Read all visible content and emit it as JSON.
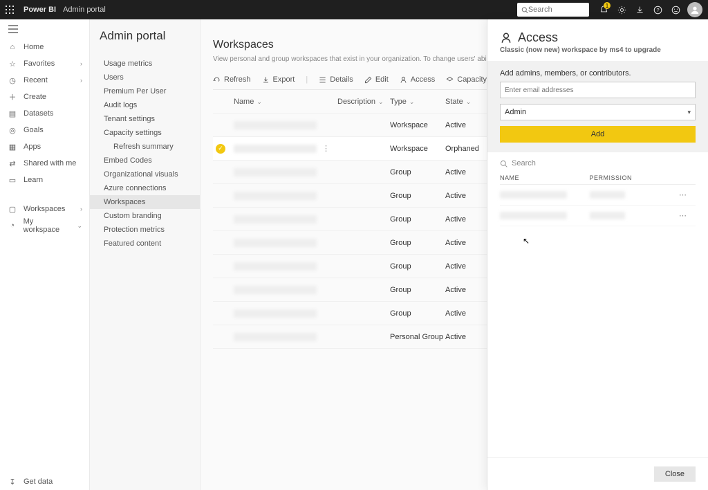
{
  "topbar": {
    "brand": "Power BI",
    "crumb": "Admin portal",
    "search_placeholder": "Search",
    "notification_count": "1"
  },
  "rail": {
    "items": [
      {
        "icon": "home",
        "label": "Home"
      },
      {
        "icon": "star",
        "label": "Favorites",
        "chevron": true
      },
      {
        "icon": "clock",
        "label": "Recent",
        "chevron": true
      },
      {
        "icon": "plus",
        "label": "Create"
      },
      {
        "icon": "db",
        "label": "Datasets"
      },
      {
        "icon": "target",
        "label": "Goals"
      },
      {
        "icon": "apps",
        "label": "Apps"
      },
      {
        "icon": "share",
        "label": "Shared with me"
      },
      {
        "icon": "book",
        "label": "Learn"
      }
    ],
    "workspaces_label": "Workspaces",
    "myworkspace_label": "My workspace",
    "getdata_label": "Get data"
  },
  "subnav": {
    "title": "Admin portal",
    "items": [
      "Usage metrics",
      "Users",
      "Premium Per User",
      "Audit logs",
      "Tenant settings",
      "Capacity settings",
      "Refresh summary",
      "Embed Codes",
      "Organizational visuals",
      "Azure connections",
      "Workspaces",
      "Custom branding",
      "Protection metrics",
      "Featured content"
    ],
    "indent_index": 6,
    "selected_index": 10
  },
  "main": {
    "heading": "Workspaces",
    "desc": "View personal and group workspaces that exist in your organization. To change users' ability to create workspac",
    "toolbar": {
      "refresh": "Refresh",
      "export": "Export",
      "details": "Details",
      "edit": "Edit",
      "access": "Access",
      "capacity": "Capacity"
    },
    "columns": {
      "name": "Name",
      "description": "Description",
      "type": "Type",
      "state": "State"
    },
    "rows": [
      {
        "type": "Workspace",
        "state": "Active"
      },
      {
        "type": "Workspace",
        "state": "Orphaned",
        "selected": true
      },
      {
        "type": "Group",
        "state": "Active"
      },
      {
        "type": "Group",
        "state": "Active"
      },
      {
        "type": "Group",
        "state": "Active"
      },
      {
        "type": "Group",
        "state": "Active"
      },
      {
        "type": "Group",
        "state": "Active"
      },
      {
        "type": "Group",
        "state": "Active"
      },
      {
        "type": "Group",
        "state": "Active"
      },
      {
        "type": "Personal Group",
        "state": "Active"
      }
    ]
  },
  "panel": {
    "title": "Access",
    "subtitle": "Classic (now new) workspace by ms4 to upgrade",
    "form_label": "Add admins, members, or contributors.",
    "email_placeholder": "Enter email addresses",
    "role_selected": "Admin",
    "add_label": "Add",
    "search_placeholder": "Search",
    "col_name": "NAME",
    "col_perm": "PERMISSION",
    "close_label": "Close",
    "rows": 2
  }
}
